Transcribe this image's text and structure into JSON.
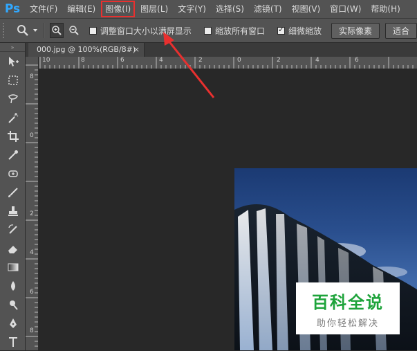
{
  "app": {
    "logo_text": "Ps",
    "logo_color": "#31a8ff"
  },
  "menu": [
    "文件(F)",
    "编辑(E)",
    "图像(I)",
    "图层(L)",
    "文字(Y)",
    "选择(S)",
    "滤镜(T)",
    "视图(V)",
    "窗口(W)",
    "帮助(H)"
  ],
  "highlighted_menu": "图像(I)",
  "annotation_color": "#e8302f",
  "options": {
    "resize_windows_label": "调整窗口大小以满屏显示",
    "resize_windows_checked": false,
    "zoom_all_windows_label": "缩放所有窗口",
    "zoom_all_windows_checked": false,
    "scrubby_zoom_label": "细微缩放",
    "scrubby_zoom_checked": true,
    "actual_pixels_label": "实际像素",
    "fit_screen_label": "适合"
  },
  "document_tab": {
    "title": "000.jpg @ 100%(RGB/8#)",
    "close_glyph": "×"
  },
  "hruler_labels": [
    "10",
    "8",
    "6",
    "4",
    "2",
    "0",
    "2",
    "4",
    "6"
  ],
  "vruler_labels": [
    "8",
    "0",
    "2",
    "4",
    "6",
    "8"
  ],
  "watermark": {
    "title": "百科全说",
    "subtitle": "助你轻松解决",
    "color": "#1da33a"
  },
  "tools": [
    "move-icon",
    "marquee-icon",
    "lasso-icon",
    "magic-wand-icon",
    "crop-icon",
    "eyedropper-icon",
    "healing-icon",
    "brush-icon",
    "stamp-icon",
    "history-brush-icon",
    "eraser-icon",
    "gradient-icon",
    "blur-icon",
    "dodge-icon",
    "pen-icon",
    "type-icon"
  ]
}
